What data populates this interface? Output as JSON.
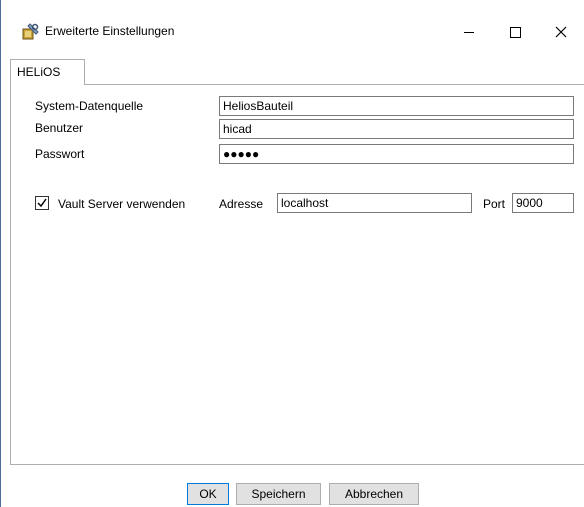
{
  "window": {
    "title": "Erweiterte Einstellungen"
  },
  "tabs": [
    {
      "label": "HELiOS"
    }
  ],
  "form": {
    "datasource_label": "System-Datenquelle",
    "datasource_value": "HeliosBauteil",
    "user_label": "Benutzer",
    "user_value": "hicad",
    "password_label": "Passwort",
    "password_value": "●●●●●",
    "vault_checkbox_label": "Vault Server verwenden",
    "vault_checked": true,
    "address_label": "Adresse",
    "address_value": "localhost",
    "port_label": "Port",
    "port_value": "9000"
  },
  "buttons": {
    "ok": "OK",
    "save": "Speichern",
    "cancel": "Abbrechen"
  },
  "icons": {
    "app": "settings-tools-icon",
    "minimize": "minimize-icon",
    "maximize": "maximize-icon",
    "close": "close-icon",
    "check": "checkmark-icon"
  },
  "colors": {
    "default_button_border": "#0078d7",
    "button_bg": "#e1e1e1"
  }
}
